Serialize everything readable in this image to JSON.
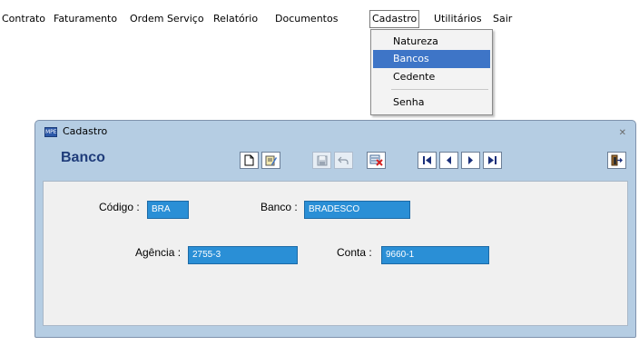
{
  "menubar": {
    "items": [
      "Contrato",
      "Faturamento",
      "Ordem Serviço",
      "Relatório",
      "Documentos",
      "Cadastro",
      "Utilitários",
      "Sair"
    ]
  },
  "dropdown": {
    "items": [
      "Natureza",
      "Bancos",
      "Cedente",
      "Senha"
    ],
    "highlighted": "Bancos"
  },
  "window": {
    "title": "Cadastro",
    "icon_text": "MPE",
    "close_glyph": "✕",
    "header": "Banco"
  },
  "toolbar": {
    "buttons": [
      "new-document-icon",
      "edit-icon",
      "save-icon",
      "undo-icon",
      "delete-icon",
      "first-record-icon",
      "previous-record-icon",
      "next-record-icon",
      "last-record-icon",
      "exit-icon"
    ]
  },
  "form": {
    "codigo_label": "Código :",
    "codigo_value": "BRA",
    "banco_label": "Banco :",
    "banco_value": "BRADESCO",
    "agencia_label": "Agência :",
    "agencia_value": "2755-3",
    "conta_label": "Conta :",
    "conta_value": "9660-1"
  },
  "colors": {
    "field_bg": "#2a8fd6",
    "window_bg": "#b5cde3",
    "menu_highlight": "#3e75c7",
    "header_text": "#1f3c7a"
  }
}
